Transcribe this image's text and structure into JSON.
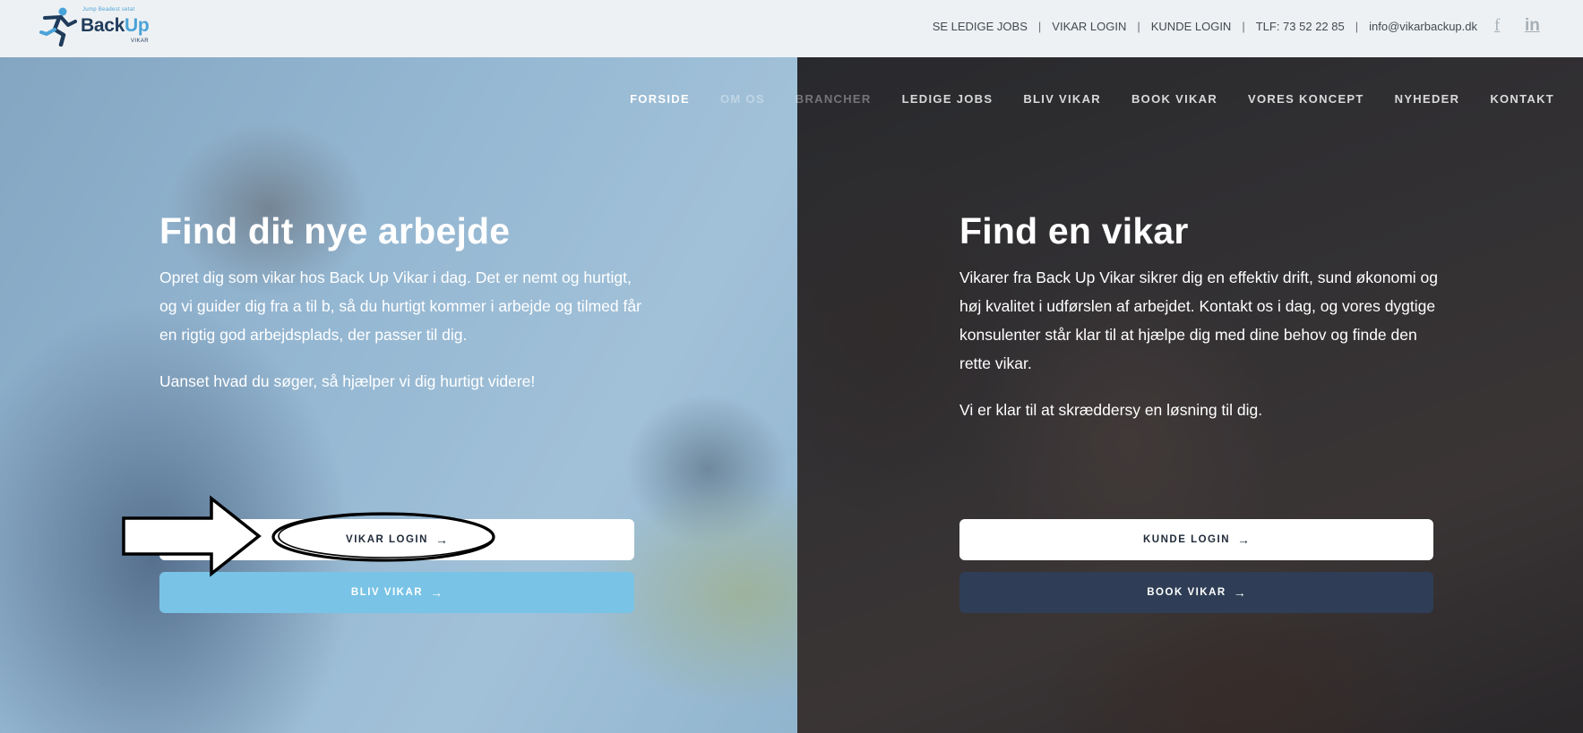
{
  "logo": {
    "tagline": "Jump Beadest setat",
    "word_back": "Back",
    "word_up": "Up",
    "sub": "VIKAR"
  },
  "utility": {
    "jobs": "SE LEDIGE JOBS",
    "vikar_login": "VIKAR LOGIN",
    "kunde_login": "KUNDE LOGIN",
    "phone": "TLF: 73 52 22 85",
    "email": "info@vikarbackup.dk",
    "separator": "|",
    "facebook_glyph": "f",
    "linkedin_glyph": "in"
  },
  "nav": {
    "items": [
      "FORSIDE",
      "OM OS",
      "BRANCHER",
      "LEDIGE JOBS",
      "BLIV VIKAR",
      "BOOK VIKAR",
      "VORES KONCEPT",
      "NYHEDER",
      "KONTAKT"
    ]
  },
  "left": {
    "title": "Find dit nye arbejde",
    "p1": "Opret dig som vikar hos Back Up Vikar i dag. Det er nemt og hurtigt, og vi guider dig fra a til b, så du hurtigt kommer i arbejde og tilmed får en rigtig god arbejdsplads, der passer til dig.",
    "p2": "Uanset hvad du søger, så hjælper vi dig hurtigt videre!",
    "btn_primary": "VIKAR LOGIN",
    "btn_secondary": "BLIV VIKAR"
  },
  "right": {
    "title": "Find en vikar",
    "p1": "Vikarer fra Back Up Vikar sikrer dig en effektiv drift, sund økonomi og høj kvalitet i udførslen af arbejdet. Kontakt os i dag, og vores dygtige konsulenter står klar til at hjælpe dig med dine behov og finde den rette vikar.",
    "p2": "Vi er klar til at skræddersy en løsning til dig.",
    "btn_primary": "KUNDE LOGIN",
    "btn_secondary": "BOOK VIKAR"
  },
  "arrow_glyph": "→",
  "colors": {
    "topbar": "#eef1f3",
    "brand_navy": "#1f3b5b",
    "brand_blue": "#4aa3d8",
    "bliv_vikar_button": "#78c3e6",
    "book_vikar_button": "#2f3e56"
  },
  "icons": [
    "runner-logo-icon",
    "facebook-icon",
    "linkedin-icon",
    "arrow-right-icon",
    "callout-arrow-icon",
    "highlight-ellipse-icon"
  ]
}
